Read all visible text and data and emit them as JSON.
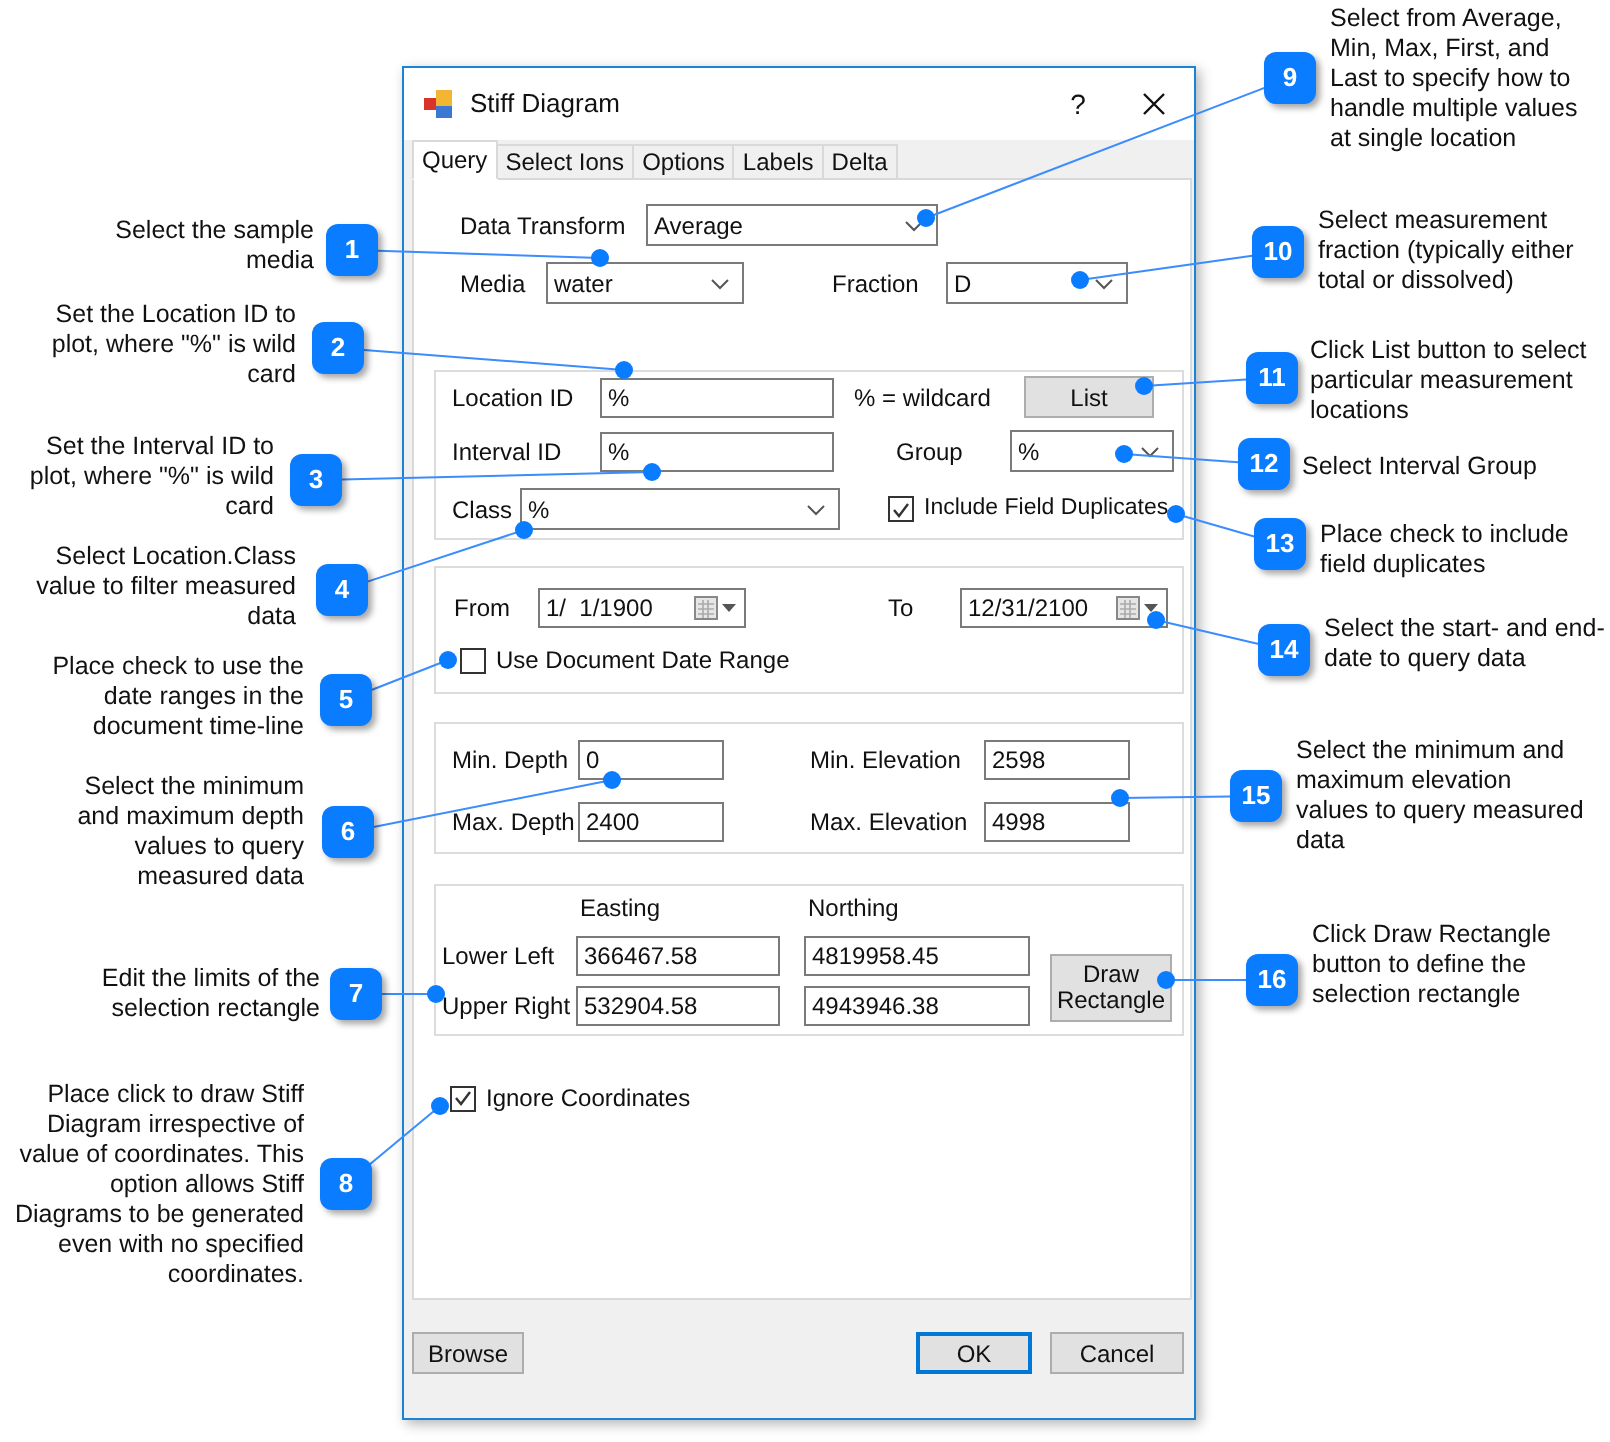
{
  "window": {
    "title": "Stiff Diagram",
    "help": "?"
  },
  "tabs": [
    {
      "label": "Query",
      "selected": true
    },
    {
      "label": "Select Ions",
      "selected": false
    },
    {
      "label": "Options",
      "selected": false
    },
    {
      "label": "Labels",
      "selected": false
    },
    {
      "label": "Delta",
      "selected": false
    }
  ],
  "query": {
    "data_transform": {
      "label": "Data Transform",
      "value": "Average"
    },
    "media": {
      "label": "Media",
      "value": "water"
    },
    "fraction": {
      "label": "Fraction",
      "value": "D"
    },
    "location_id": {
      "label": "Location ID",
      "value": "%"
    },
    "wildcard_note": "% = wildcard",
    "list_button": "List",
    "interval_id": {
      "label": "Interval ID",
      "value": "%"
    },
    "group": {
      "label": "Group",
      "value": "%"
    },
    "class": {
      "label": "Class",
      "value": "%"
    },
    "include_field_duplicates": {
      "label": "Include Field Duplicates",
      "checked": true
    },
    "from": {
      "label": "From",
      "value": "1/  1/1900"
    },
    "to": {
      "label": "To",
      "value": "12/31/2100"
    },
    "use_document_date_range": {
      "label": "Use Document Date Range",
      "checked": false
    },
    "min_depth": {
      "label": "Min. Depth",
      "value": "0"
    },
    "max_depth": {
      "label": "Max. Depth",
      "value": "2400"
    },
    "min_elevation": {
      "label": "Min. Elevation",
      "value": "2598"
    },
    "max_elevation": {
      "label": "Max. Elevation",
      "value": "4998"
    },
    "coordinates": {
      "easting_header": "Easting",
      "northing_header": "Northing",
      "rows": [
        {
          "label": "Lower Left",
          "easting": "366467.58",
          "northing": "4819958.45"
        },
        {
          "label": "Upper Right",
          "easting": "532904.58",
          "northing": "4943946.38"
        }
      ]
    },
    "draw_rectangle_button": "Draw Rectangle",
    "ignore_coordinates": {
      "label": "Ignore Coordinates",
      "checked": true
    }
  },
  "buttons": [
    {
      "label": "Browse",
      "default": false
    },
    {
      "label": "OK",
      "default": true
    },
    {
      "label": "Cancel",
      "default": false
    }
  ],
  "callouts": [
    {
      "number": "1",
      "text": "Select the sample media"
    },
    {
      "number": "2",
      "text": "Set the Location ID to plot, where \"%\" is wild card"
    },
    {
      "number": "3",
      "text": "Set the Interval ID to plot, where \"%\" is wild card"
    },
    {
      "number": "4",
      "text": "Select Location.Class value to filter measured data"
    },
    {
      "number": "5",
      "text": "Place check to use the date ranges in the document time-line"
    },
    {
      "number": "6",
      "text": "Select the minimum and maximum depth values to query measured data"
    },
    {
      "number": "7",
      "text": "Edit the limits of the selection rectangle"
    },
    {
      "number": "8",
      "text": "Place click to draw Stiff Diagram irrespective of value of coordinates. This option allows Stiff Diagrams to be generated even with no specified coordinates."
    },
    {
      "number": "9",
      "text": "Select from Average, Min, Max, First, and Last to specify how to handle multiple values at single location"
    },
    {
      "number": "10",
      "text": "Select measurement fraction (typically either total or dissolved)"
    },
    {
      "number": "11",
      "text": "Click List button to select particular measurement locations"
    },
    {
      "number": "12",
      "text": "Select Interval Group"
    },
    {
      "number": "13",
      "text": "Place check to include field duplicates"
    },
    {
      "number": "14",
      "text": "Select the start- and end-date to query data"
    },
    {
      "number": "15",
      "text": "Select the minimum and maximum elevation values to query measured data"
    },
    {
      "number": "16",
      "text": "Click Draw Rectangle button to define the selection rectangle"
    }
  ]
}
